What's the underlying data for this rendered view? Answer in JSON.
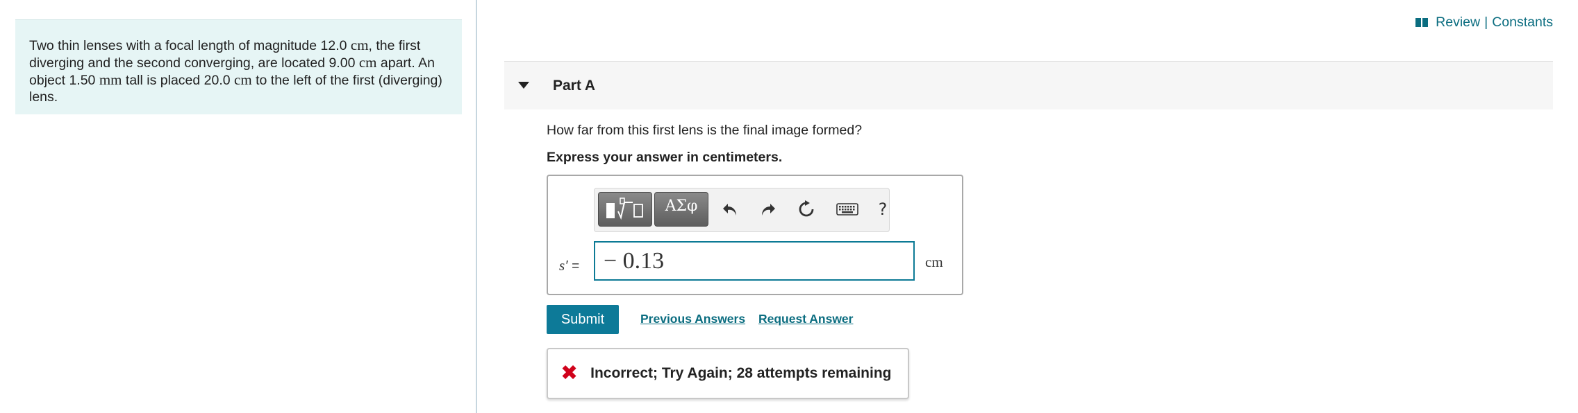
{
  "problem": {
    "p1": "Two thin lenses with a focal length of magnitude 12.0 ",
    "focal_unit": "cm",
    "p2": ", the first diverging and the second converging, are located 9.00 ",
    "sep_unit": "cm",
    "p3": " apart. An object 1.50 ",
    "height_unit": "mm",
    "p4": " tall is placed 20.0 ",
    "dist_unit": "cm",
    "p5": " to the left of the first (diverging) lens."
  },
  "top_links": {
    "review": "Review",
    "separator": "|",
    "constants": "Constants"
  },
  "part": {
    "title": "Part A",
    "question": "How far from this first lens is the final image formed?",
    "instruction": "Express your answer in centimeters."
  },
  "answer": {
    "variable": "s′",
    "equals": "=",
    "value": "− 0.13",
    "unit": "cm"
  },
  "toolbar": {
    "greek_label": "ΑΣφ",
    "help_label": "?"
  },
  "actions": {
    "submit": "Submit",
    "previous_answers": "Previous Answers",
    "request_answer": "Request Answer"
  },
  "feedback": {
    "icon": "✖",
    "message": "Incorrect; Try Again; 28 attempts remaining"
  },
  "colors": {
    "accent": "#0d7a98",
    "link": "#0b6d80",
    "error": "#d0021b",
    "problem_bg": "#e6f5f5"
  }
}
